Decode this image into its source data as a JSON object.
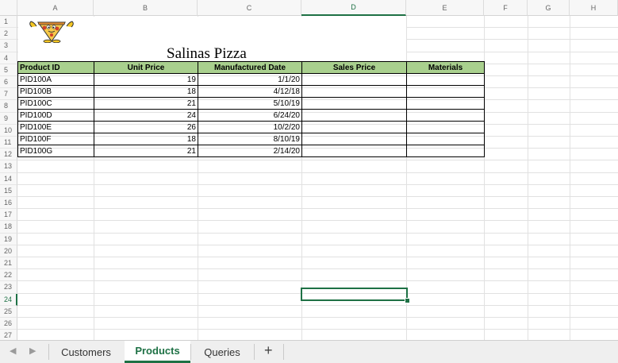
{
  "columns": [
    "A",
    "B",
    "C",
    "D",
    "E",
    "F",
    "G",
    "H"
  ],
  "rows": [
    "1",
    "2",
    "3",
    "4",
    "5",
    "6",
    "7",
    "8",
    "9",
    "10",
    "11",
    "12",
    "13",
    "14",
    "15",
    "16",
    "17",
    "18",
    "19",
    "20",
    "21",
    "22",
    "23",
    "24",
    "25",
    "26",
    "27"
  ],
  "sheet_title": "Salinas Pizza",
  "headers": [
    "Product ID",
    "Unit Price",
    "Manufactured Date",
    "Sales Price",
    "Materials"
  ],
  "table": [
    [
      "PID100A",
      "19",
      "1/1/20",
      "",
      ""
    ],
    [
      "PID100B",
      "18",
      "4/12/18",
      "",
      ""
    ],
    [
      "PID100C",
      "21",
      "5/10/19",
      "",
      ""
    ],
    [
      "PID100D",
      "24",
      "6/24/20",
      "",
      ""
    ],
    [
      "PID100E",
      "26",
      "10/2/20",
      "",
      ""
    ],
    [
      "PID100F",
      "18",
      "8/10/19",
      "",
      ""
    ],
    [
      "PID100G",
      "21",
      "2/14/20",
      "",
      ""
    ]
  ],
  "active_cell": {
    "column": "D",
    "row": "24"
  },
  "tabs": {
    "customers": "Customers",
    "products": "Products",
    "queries": "Queries",
    "add": "+",
    "prev": "◀",
    "next": "▶"
  },
  "logo_icon": "pizza-mascot-icon",
  "colors": {
    "header_fill": "#a9d08e",
    "accent": "#1e7145"
  }
}
